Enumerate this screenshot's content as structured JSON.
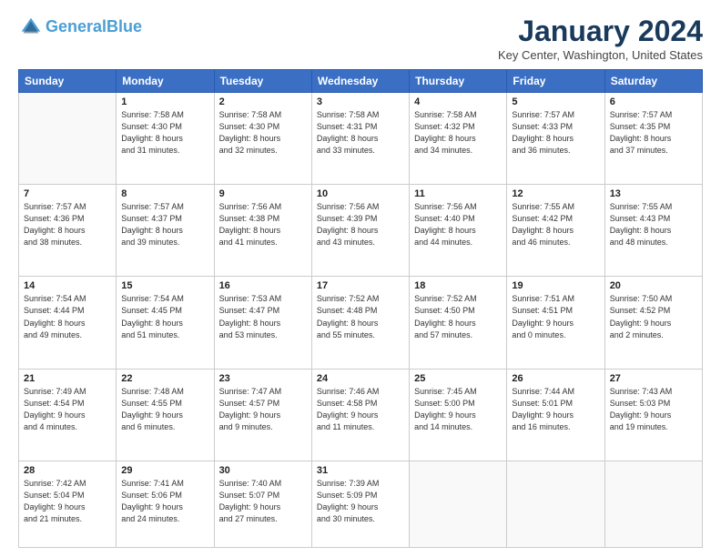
{
  "logo": {
    "line1": "General",
    "line2": "Blue"
  },
  "title": "January 2024",
  "location": "Key Center, Washington, United States",
  "days_of_week": [
    "Sunday",
    "Monday",
    "Tuesday",
    "Wednesday",
    "Thursday",
    "Friday",
    "Saturday"
  ],
  "weeks": [
    [
      {
        "day": "",
        "info": ""
      },
      {
        "day": "1",
        "info": "Sunrise: 7:58 AM\nSunset: 4:30 PM\nDaylight: 8 hours\nand 31 minutes."
      },
      {
        "day": "2",
        "info": "Sunrise: 7:58 AM\nSunset: 4:30 PM\nDaylight: 8 hours\nand 32 minutes."
      },
      {
        "day": "3",
        "info": "Sunrise: 7:58 AM\nSunset: 4:31 PM\nDaylight: 8 hours\nand 33 minutes."
      },
      {
        "day": "4",
        "info": "Sunrise: 7:58 AM\nSunset: 4:32 PM\nDaylight: 8 hours\nand 34 minutes."
      },
      {
        "day": "5",
        "info": "Sunrise: 7:57 AM\nSunset: 4:33 PM\nDaylight: 8 hours\nand 36 minutes."
      },
      {
        "day": "6",
        "info": "Sunrise: 7:57 AM\nSunset: 4:35 PM\nDaylight: 8 hours\nand 37 minutes."
      }
    ],
    [
      {
        "day": "7",
        "info": "Sunrise: 7:57 AM\nSunset: 4:36 PM\nDaylight: 8 hours\nand 38 minutes."
      },
      {
        "day": "8",
        "info": "Sunrise: 7:57 AM\nSunset: 4:37 PM\nDaylight: 8 hours\nand 39 minutes."
      },
      {
        "day": "9",
        "info": "Sunrise: 7:56 AM\nSunset: 4:38 PM\nDaylight: 8 hours\nand 41 minutes."
      },
      {
        "day": "10",
        "info": "Sunrise: 7:56 AM\nSunset: 4:39 PM\nDaylight: 8 hours\nand 43 minutes."
      },
      {
        "day": "11",
        "info": "Sunrise: 7:56 AM\nSunset: 4:40 PM\nDaylight: 8 hours\nand 44 minutes."
      },
      {
        "day": "12",
        "info": "Sunrise: 7:55 AM\nSunset: 4:42 PM\nDaylight: 8 hours\nand 46 minutes."
      },
      {
        "day": "13",
        "info": "Sunrise: 7:55 AM\nSunset: 4:43 PM\nDaylight: 8 hours\nand 48 minutes."
      }
    ],
    [
      {
        "day": "14",
        "info": "Sunrise: 7:54 AM\nSunset: 4:44 PM\nDaylight: 8 hours\nand 49 minutes."
      },
      {
        "day": "15",
        "info": "Sunrise: 7:54 AM\nSunset: 4:45 PM\nDaylight: 8 hours\nand 51 minutes."
      },
      {
        "day": "16",
        "info": "Sunrise: 7:53 AM\nSunset: 4:47 PM\nDaylight: 8 hours\nand 53 minutes."
      },
      {
        "day": "17",
        "info": "Sunrise: 7:52 AM\nSunset: 4:48 PM\nDaylight: 8 hours\nand 55 minutes."
      },
      {
        "day": "18",
        "info": "Sunrise: 7:52 AM\nSunset: 4:50 PM\nDaylight: 8 hours\nand 57 minutes."
      },
      {
        "day": "19",
        "info": "Sunrise: 7:51 AM\nSunset: 4:51 PM\nDaylight: 9 hours\nand 0 minutes."
      },
      {
        "day": "20",
        "info": "Sunrise: 7:50 AM\nSunset: 4:52 PM\nDaylight: 9 hours\nand 2 minutes."
      }
    ],
    [
      {
        "day": "21",
        "info": "Sunrise: 7:49 AM\nSunset: 4:54 PM\nDaylight: 9 hours\nand 4 minutes."
      },
      {
        "day": "22",
        "info": "Sunrise: 7:48 AM\nSunset: 4:55 PM\nDaylight: 9 hours\nand 6 minutes."
      },
      {
        "day": "23",
        "info": "Sunrise: 7:47 AM\nSunset: 4:57 PM\nDaylight: 9 hours\nand 9 minutes."
      },
      {
        "day": "24",
        "info": "Sunrise: 7:46 AM\nSunset: 4:58 PM\nDaylight: 9 hours\nand 11 minutes."
      },
      {
        "day": "25",
        "info": "Sunrise: 7:45 AM\nSunset: 5:00 PM\nDaylight: 9 hours\nand 14 minutes."
      },
      {
        "day": "26",
        "info": "Sunrise: 7:44 AM\nSunset: 5:01 PM\nDaylight: 9 hours\nand 16 minutes."
      },
      {
        "day": "27",
        "info": "Sunrise: 7:43 AM\nSunset: 5:03 PM\nDaylight: 9 hours\nand 19 minutes."
      }
    ],
    [
      {
        "day": "28",
        "info": "Sunrise: 7:42 AM\nSunset: 5:04 PM\nDaylight: 9 hours\nand 21 minutes."
      },
      {
        "day": "29",
        "info": "Sunrise: 7:41 AM\nSunset: 5:06 PM\nDaylight: 9 hours\nand 24 minutes."
      },
      {
        "day": "30",
        "info": "Sunrise: 7:40 AM\nSunset: 5:07 PM\nDaylight: 9 hours\nand 27 minutes."
      },
      {
        "day": "31",
        "info": "Sunrise: 7:39 AM\nSunset: 5:09 PM\nDaylight: 9 hours\nand 30 minutes."
      },
      {
        "day": "",
        "info": ""
      },
      {
        "day": "",
        "info": ""
      },
      {
        "day": "",
        "info": ""
      }
    ]
  ]
}
